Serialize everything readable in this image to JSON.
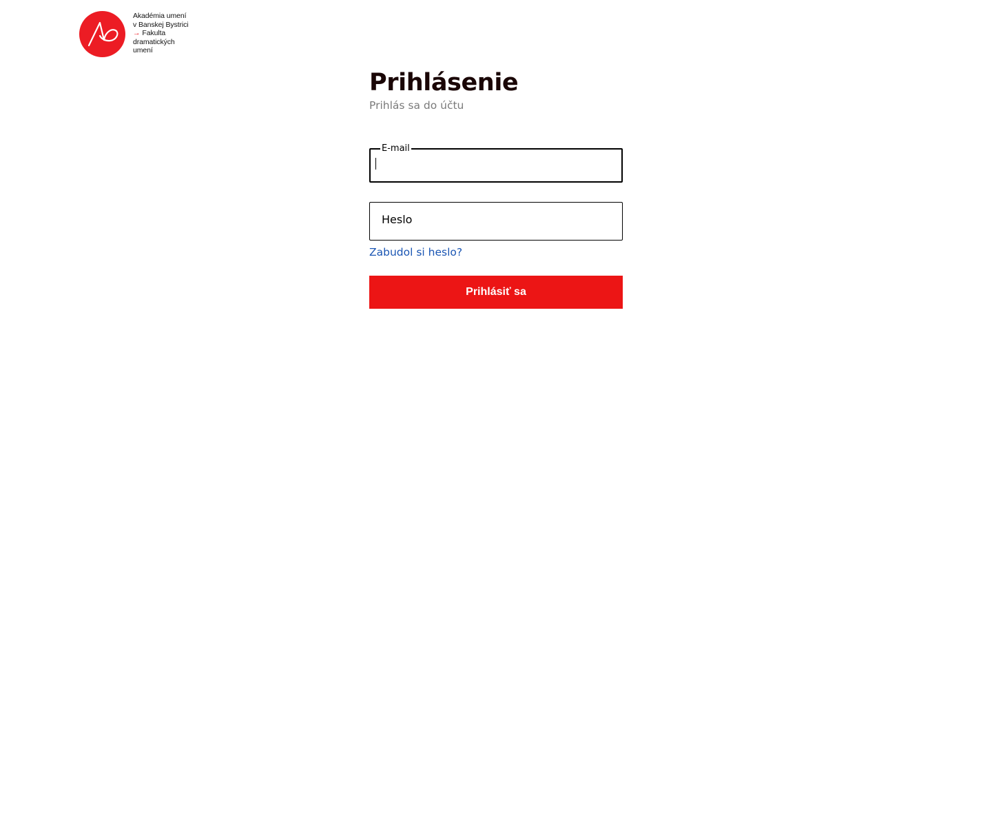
{
  "logo": {
    "icon": "aa-logo-icon",
    "lines": [
      "Akadémia umení",
      "v Banskej Bystrici",
      "Fakulta",
      "dramatických",
      "umení"
    ],
    "arrow": "→",
    "brand_color": "#ec1c24"
  },
  "login": {
    "title": "Prihlásenie",
    "subtitle": "Prihlás sa do účtu",
    "email": {
      "label": "E-mail",
      "value": ""
    },
    "password": {
      "placeholder": "Heslo",
      "value": ""
    },
    "forgot_label": "Zabudol si heslo?",
    "submit_label": "Prihlásiť sa"
  },
  "colors": {
    "accent": "#ec1515",
    "link": "#1a55b3",
    "title": "#1a0606",
    "subtitle": "#7a7a7a"
  }
}
